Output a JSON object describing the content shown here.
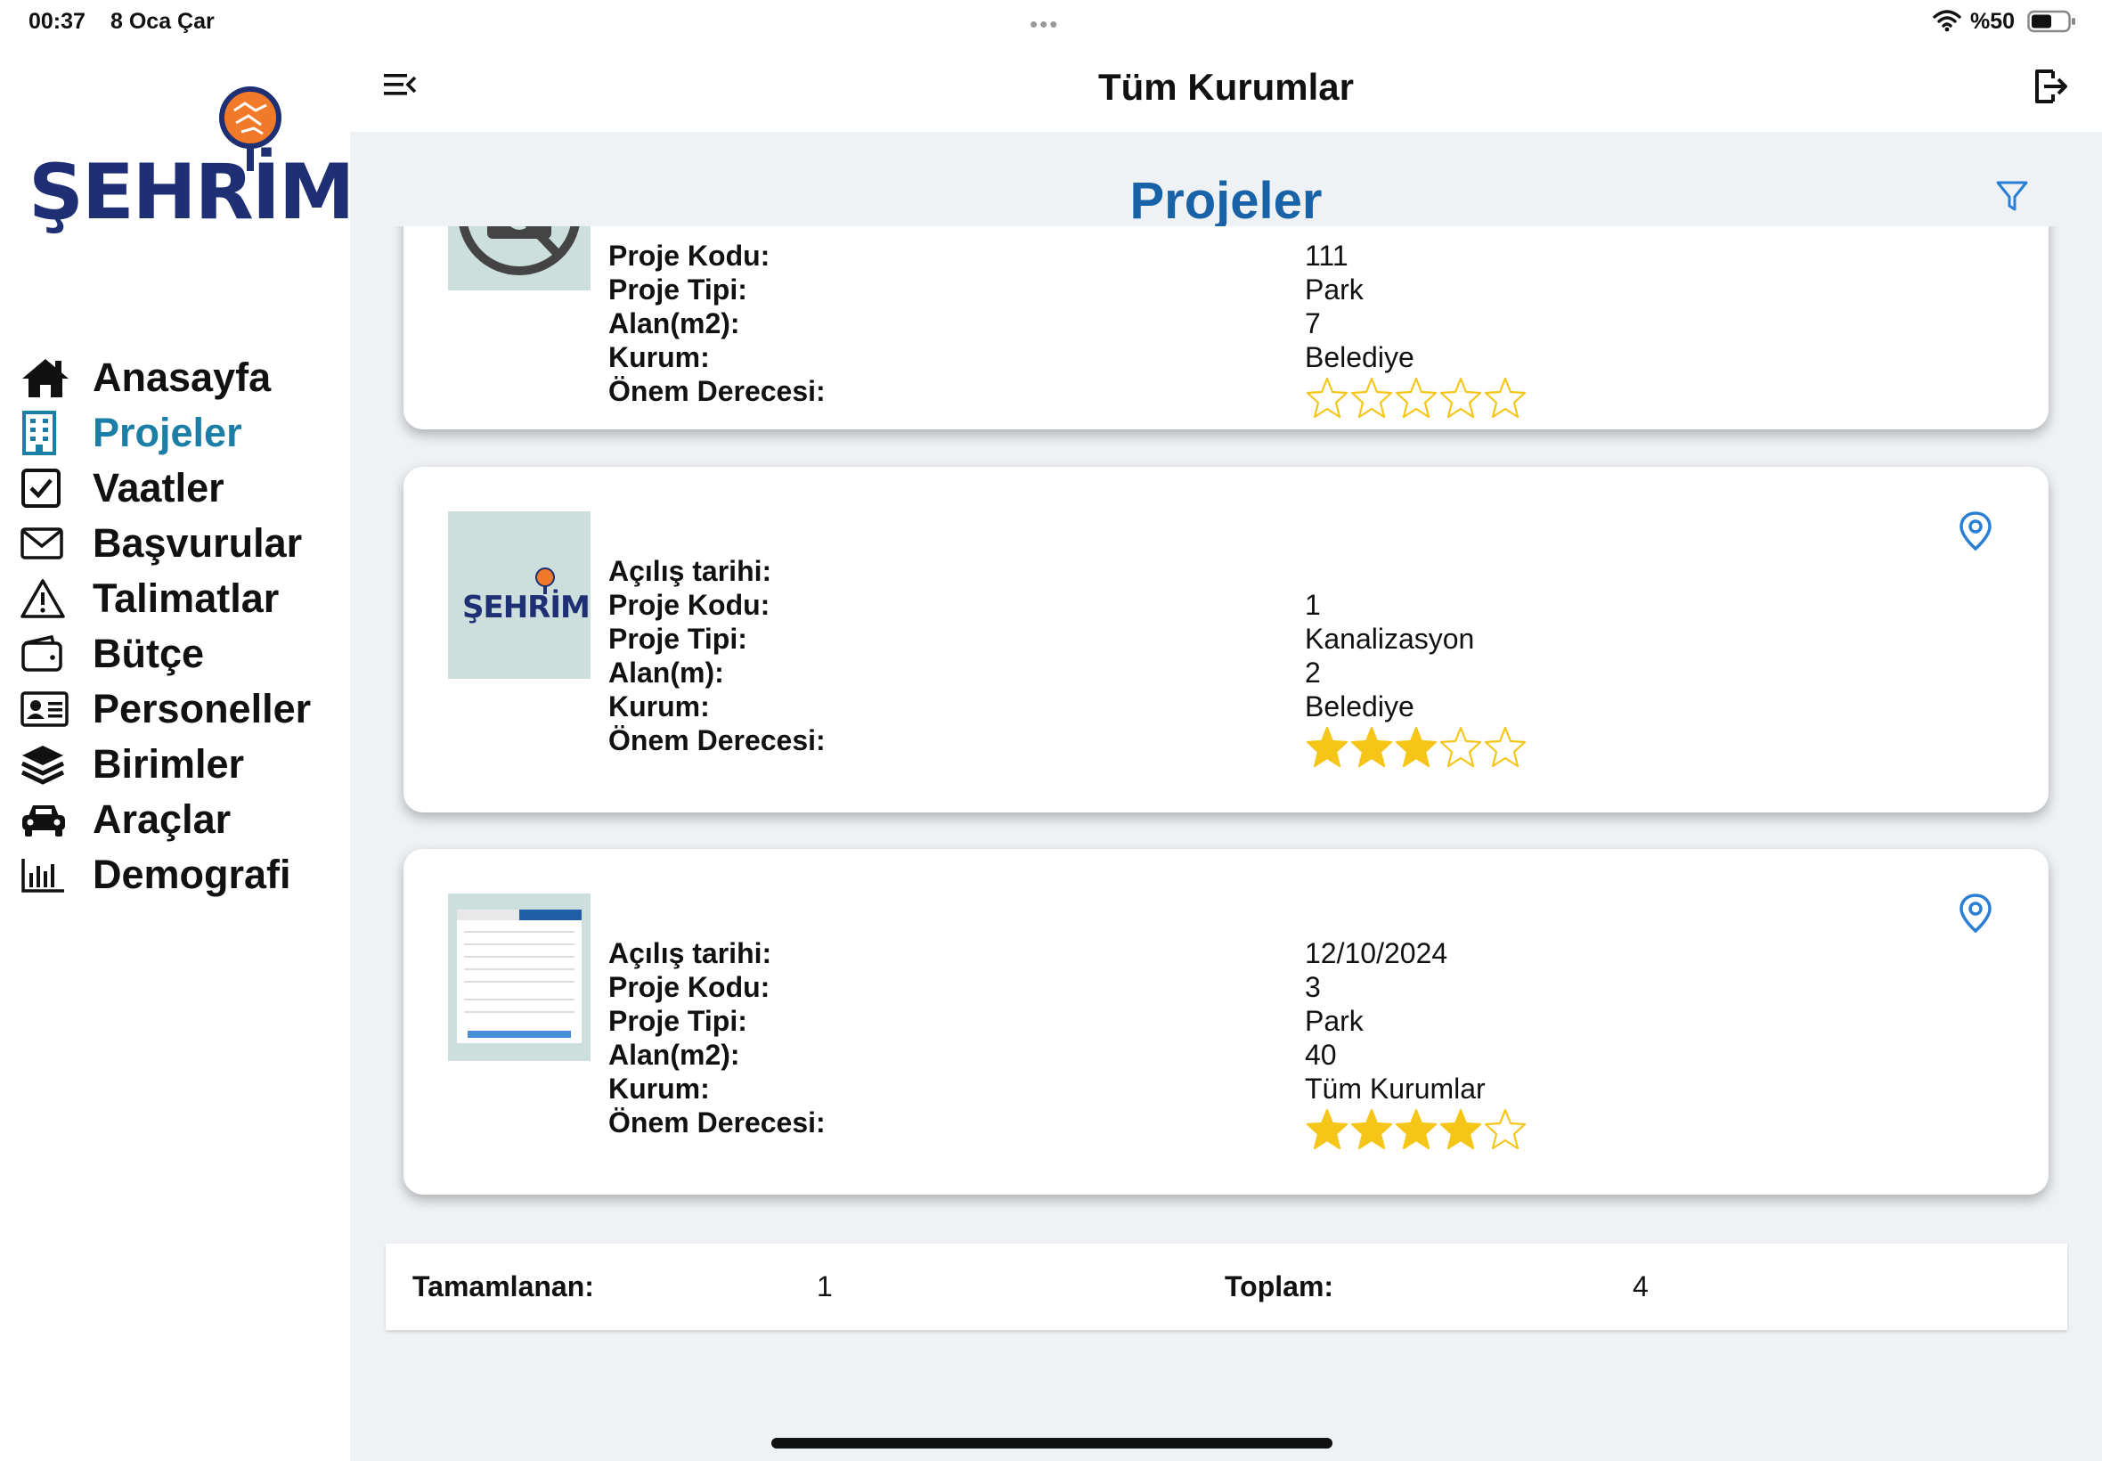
{
  "status_bar": {
    "time": "00:37",
    "date": "8 Oca Çar",
    "battery": "%50"
  },
  "sidebar": {
    "logo_text": "ŞEHRİM",
    "items": [
      {
        "label": "Anasayfa",
        "icon": "home-icon"
      },
      {
        "label": "Projeler",
        "icon": "building-icon",
        "active": true
      },
      {
        "label": "Vaatler",
        "icon": "checkbox-icon"
      },
      {
        "label": "Başvurular",
        "icon": "mail-icon"
      },
      {
        "label": "Talimatlar",
        "icon": "warning-icon"
      },
      {
        "label": "Bütçe",
        "icon": "wallet-icon"
      },
      {
        "label": "Personeller",
        "icon": "id-card-icon"
      },
      {
        "label": "Birimler",
        "icon": "layers-icon"
      },
      {
        "label": "Araçlar",
        "icon": "car-icon"
      },
      {
        "label": "Demografi",
        "icon": "bar-chart-icon"
      }
    ]
  },
  "header": {
    "title": "Tüm Kurumlar"
  },
  "main": {
    "page_title": "Projeler"
  },
  "projects": [
    {
      "labels": [
        "Proje Kodu:",
        "Proje Tipi:",
        "Alan(m2):",
        "Kurum:",
        "Önem Derecesi:"
      ],
      "values": [
        "111",
        "Park",
        "7",
        "Belediye"
      ],
      "rating": 0,
      "max_rating": 5,
      "thumbnail": "no-photo"
    },
    {
      "labels": [
        "Açılış tarihi:",
        "Proje Kodu:",
        "Proje Tipi:",
        "Alan(m):",
        "Kurum:",
        "Önem Derecesi:"
      ],
      "values": [
        "",
        "1",
        "Kanalizasyon",
        "2",
        "Belediye"
      ],
      "rating": 3,
      "max_rating": 5,
      "thumbnail": "logo",
      "thumb_logo_text": "ŞEHRİM"
    },
    {
      "labels": [
        "Açılış tarihi:",
        "Proje Kodu:",
        "Proje Tipi:",
        "Alan(m2):",
        "Kurum:",
        "Önem Derecesi:"
      ],
      "values": [
        "12/10/2024",
        "3",
        "Park",
        "40",
        "Tüm Kurumlar"
      ],
      "rating": 4,
      "max_rating": 5,
      "thumbnail": "form-screenshot"
    }
  ],
  "summary": {
    "completed_label": "Tamamlanan:",
    "completed_value": "1",
    "total_label": "Toplam:",
    "total_value": "4"
  },
  "colors": {
    "accent": "#1a7ea7",
    "title_blue": "#1862a8",
    "star": "#f5c518",
    "pin": "#2a7fd4",
    "logo_navy": "#1f2f73",
    "logo_orange": "#f07a2a"
  }
}
